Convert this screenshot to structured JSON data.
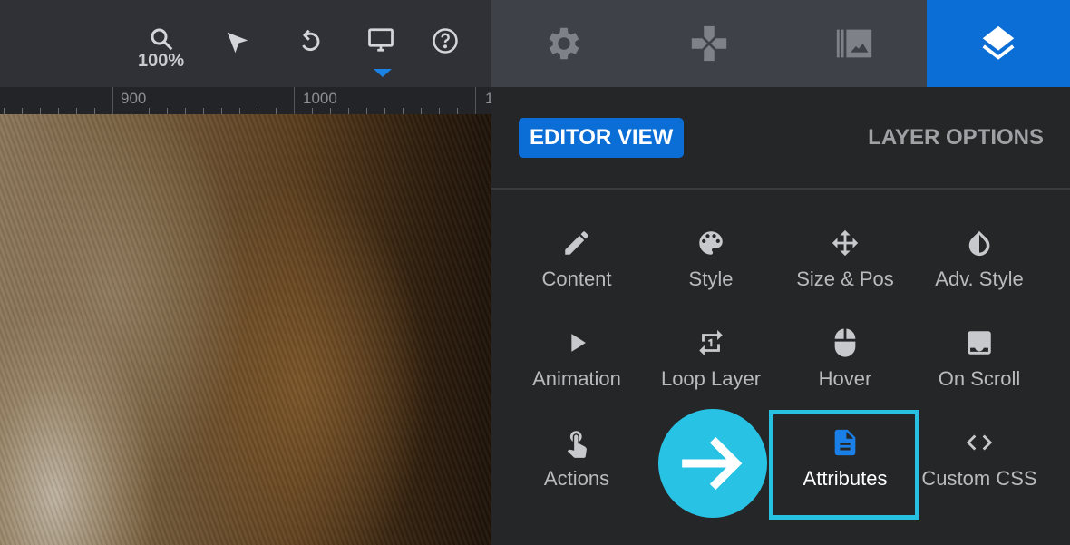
{
  "toolbar": {
    "zoom_level": "100%",
    "icons": [
      "search-icon",
      "pointer-icon",
      "undo-icon",
      "desktop-icon",
      "help-icon"
    ]
  },
  "ruler": {
    "labels": [
      "900",
      "1000",
      "1"
    ]
  },
  "tabs": [
    {
      "icon": "gear-icon"
    },
    {
      "icon": "gamepad-icon"
    },
    {
      "icon": "media-library-icon"
    },
    {
      "icon": "layers-icon",
      "active": true
    }
  ],
  "panel": {
    "editor_view": "EDITOR VIEW",
    "layer_options": "LAYER OPTIONS",
    "options": [
      {
        "label": "Content",
        "icon": "pencil-icon"
      },
      {
        "label": "Style",
        "icon": "palette-icon"
      },
      {
        "label": "Size & Pos",
        "icon": "move-icon"
      },
      {
        "label": "Adv. Style",
        "icon": "drop-icon"
      },
      {
        "label": "Animation",
        "icon": "play-icon"
      },
      {
        "label": "Loop Layer",
        "icon": "repeat-icon"
      },
      {
        "label": "Hover",
        "icon": "mouse-icon"
      },
      {
        "label": "On Scroll",
        "icon": "download-box-icon"
      },
      {
        "label": "Actions",
        "icon": "touch-icon"
      },
      {
        "label": "Attributes",
        "icon": "document-icon",
        "highlighted": true
      },
      {
        "label": "Custom CSS",
        "icon": "code-icon"
      }
    ]
  },
  "colors": {
    "accent": "#0b6dd6",
    "highlight": "#27c0e0"
  }
}
